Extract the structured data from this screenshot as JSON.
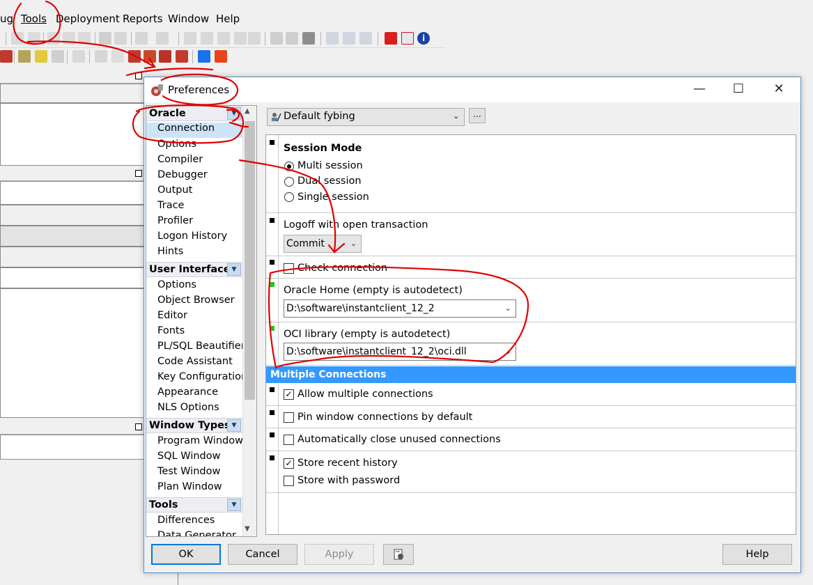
{
  "menubar": {
    "items": [
      "ug",
      "Tools",
      "Deployment",
      "Reports",
      "Window",
      "Help"
    ]
  },
  "dialog": {
    "title": "Preferences",
    "minimize": "—",
    "maximize": "☐",
    "close": "✕"
  },
  "tree": {
    "groups": [
      {
        "label": "Oracle",
        "items": [
          "Connection",
          "Options",
          "Compiler",
          "Debugger",
          "Output",
          "Trace",
          "Profiler",
          "Logon History",
          "Hints"
        ]
      },
      {
        "label": "User Interface",
        "items": [
          "Options",
          "Object Browser",
          "Editor",
          "Fonts",
          "PL/SQL Beautifier",
          "Code Assistant",
          "Key Configuration",
          "Appearance",
          "NLS Options"
        ]
      },
      {
        "label": "Window Types",
        "items": [
          "Program Window",
          "SQL Window",
          "Test Window",
          "Plan Window"
        ]
      },
      {
        "label": "Tools",
        "items": [
          "Differences",
          "Data Generator"
        ]
      }
    ],
    "selected": "Connection"
  },
  "profile": {
    "value": "Default fybing",
    "more": "..."
  },
  "session": {
    "heading": "Session Mode",
    "options": [
      "Multi session",
      "Dual session",
      "Single session"
    ],
    "selected": "Multi session"
  },
  "logoff": {
    "label": "Logoff with open transaction",
    "value": "Commit"
  },
  "check_connection": {
    "label": "Check connection",
    "checked": false
  },
  "oracle_home": {
    "label": "Oracle Home (empty is autodetect)",
    "value": "D:\\software\\instantclient_12_2"
  },
  "oci_library": {
    "label": "OCI library (empty is autodetect)",
    "value": "D:\\software\\instantclient_12_2\\oci.dll"
  },
  "multiple": {
    "heading": "Multiple Connections",
    "allow": {
      "label": "Allow multiple connections",
      "checked": true
    },
    "pin": {
      "label": "Pin window connections by default",
      "checked": false
    },
    "autoclose": {
      "label": "Automatically close unused connections",
      "checked": false
    },
    "store_recent": {
      "label": "Store recent history",
      "checked": true
    },
    "store_password": {
      "label": "Store with password",
      "checked": false
    }
  },
  "buttons": {
    "ok": "OK",
    "cancel": "Cancel",
    "apply": "Apply",
    "help": "Help"
  },
  "colors": {
    "accent": "#3399ff",
    "selection": "#cde4f7",
    "annotation": "#e00000",
    "status_ok": "#1ec81e"
  },
  "icons": {
    "title": "preferences-gear-icon",
    "profile": "user-wand-icon",
    "dropdown": "chevron-down-icon",
    "properties": "properties-icon"
  }
}
